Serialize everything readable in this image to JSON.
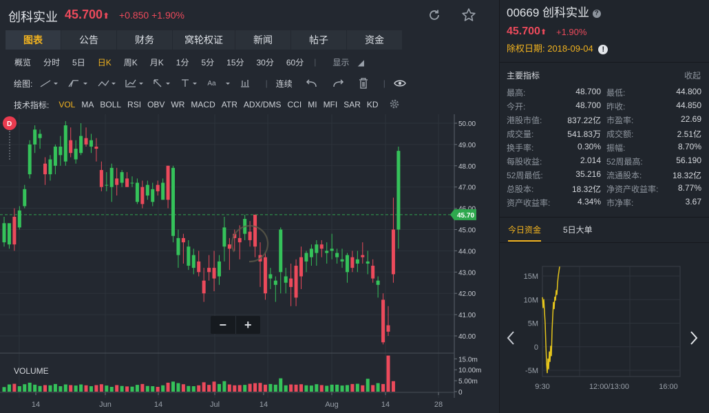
{
  "header": {
    "title": "创科实业",
    "price": "45.700",
    "up_arrow": "⬆",
    "change": "+0.850 +1.90%",
    "refresh_icon": "refresh-icon",
    "star_icon": "star-icon"
  },
  "tabs": [
    "图表",
    "公告",
    "财务",
    "窝轮权证",
    "新闻",
    "帖子",
    "资金"
  ],
  "periods": [
    "概览",
    "分时",
    "5日",
    "日K",
    "周K",
    "月K",
    "1分",
    "5分",
    "15分",
    "30分",
    "60分"
  ],
  "display_label": "显示",
  "draw": {
    "label": "绘图:",
    "tool_aa": "Aa",
    "continuous": "连续"
  },
  "indicators": {
    "label": "技术指标:",
    "items": [
      "VOL",
      "MA",
      "BOLL",
      "RSI",
      "OBV",
      "WR",
      "MACD",
      "ATR",
      "ADX/DMS",
      "CCI",
      "MI",
      "MFI",
      "SAR",
      "KD"
    ]
  },
  "chart_data": {
    "type": "candlestick",
    "y_ticks": [
      "50.00",
      "49.00",
      "48.00",
      "47.00",
      "46.00",
      "45.00",
      "44.00",
      "43.00",
      "42.00",
      "41.00",
      "40.00"
    ],
    "ylim": [
      39.5,
      50.2
    ],
    "x_ticks": [
      "14",
      "Jun",
      "14",
      "Jul",
      "14",
      "Aug",
      "14",
      "28"
    ],
    "current_price_label": "45.70",
    "marker_label": "D",
    "volume_label": "VOLUME",
    "volume_ticks": [
      "15.0m",
      "10.00m",
      "5.00m",
      "0"
    ],
    "colors": {
      "up": "#35c25a",
      "down": "#ec4a5b",
      "last_line": "#35c25a"
    },
    "candles": [
      {
        "o": 44.4,
        "h": 45.6,
        "l": 44.2,
        "c": 45.3
      },
      {
        "o": 44.3,
        "h": 45.0,
        "l": 44.1,
        "c": 45.3
      },
      {
        "o": 45.6,
        "h": 46.0,
        "l": 44.0,
        "c": 44.3
      },
      {
        "o": 45.1,
        "h": 46.1,
        "l": 45.0,
        "c": 45.9
      },
      {
        "o": 46.1,
        "h": 47.1,
        "l": 46.0,
        "c": 46.9
      },
      {
        "o": 47.6,
        "h": 49.2,
        "l": 47.4,
        "c": 49.0
      },
      {
        "o": 49.0,
        "h": 49.9,
        "l": 48.6,
        "c": 49.7
      },
      {
        "o": 49.3,
        "h": 49.7,
        "l": 48.8,
        "c": 49.5
      },
      {
        "o": 48.1,
        "h": 48.4,
        "l": 47.1,
        "c": 47.6
      },
      {
        "o": 47.6,
        "h": 48.5,
        "l": 47.3,
        "c": 48.3
      },
      {
        "o": 48.0,
        "h": 49.0,
        "l": 47.6,
        "c": 48.9
      },
      {
        "o": 48.5,
        "h": 49.4,
        "l": 48.0,
        "c": 48.9
      },
      {
        "o": 48.2,
        "h": 50.1,
        "l": 48.0,
        "c": 49.9
      },
      {
        "o": 49.2,
        "h": 49.8,
        "l": 48.4,
        "c": 48.6
      },
      {
        "o": 48.3,
        "h": 49.2,
        "l": 48.1,
        "c": 48.8
      },
      {
        "o": 48.6,
        "h": 50.0,
        "l": 48.5,
        "c": 49.4
      },
      {
        "o": 49.3,
        "h": 49.8,
        "l": 48.9,
        "c": 49.0
      },
      {
        "o": 48.9,
        "h": 49.5,
        "l": 48.6,
        "c": 49.2
      },
      {
        "o": 48.9,
        "h": 49.3,
        "l": 48.2,
        "c": 48.8
      },
      {
        "o": 47.8,
        "h": 48.2,
        "l": 46.8,
        "c": 47.0
      },
      {
        "o": 47.1,
        "h": 47.7,
        "l": 46.8,
        "c": 47.1
      },
      {
        "o": 47.0,
        "h": 48.1,
        "l": 46.3,
        "c": 47.9
      },
      {
        "o": 47.4,
        "h": 47.9,
        "l": 46.6,
        "c": 47.1
      },
      {
        "o": 47.2,
        "h": 47.8,
        "l": 47.0,
        "c": 47.7
      },
      {
        "o": 47.4,
        "h": 47.7,
        "l": 47.0,
        "c": 47.0
      },
      {
        "o": 47.2,
        "h": 47.5,
        "l": 47.0,
        "c": 47.2
      },
      {
        "o": 46.3,
        "h": 47.4,
        "l": 46.2,
        "c": 47.2
      },
      {
        "o": 47.0,
        "h": 47.3,
        "l": 46.0,
        "c": 46.2
      },
      {
        "o": 46.6,
        "h": 47.3,
        "l": 46.4,
        "c": 47.1
      },
      {
        "o": 46.3,
        "h": 47.2,
        "l": 46.1,
        "c": 46.9
      },
      {
        "o": 47.1,
        "h": 47.3,
        "l": 46.6,
        "c": 46.8
      },
      {
        "o": 46.4,
        "h": 47.4,
        "l": 46.4,
        "c": 47.2
      },
      {
        "o": 48.0,
        "h": 48.0,
        "l": 46.0,
        "c": 46.4
      },
      {
        "o": 44.7,
        "h": 48.0,
        "l": 44.4,
        "c": 47.9
      },
      {
        "o": 43.8,
        "h": 45.0,
        "l": 43.2,
        "c": 44.6
      },
      {
        "o": 44.6,
        "h": 44.8,
        "l": 43.4,
        "c": 44.4
      },
      {
        "o": 43.3,
        "h": 44.5,
        "l": 43.1,
        "c": 44.2
      },
      {
        "o": 43.2,
        "h": 44.1,
        "l": 42.9,
        "c": 43.8
      },
      {
        "o": 43.5,
        "h": 44.0,
        "l": 42.8,
        "c": 43.0
      },
      {
        "o": 42.6,
        "h": 43.2,
        "l": 41.6,
        "c": 42.0
      },
      {
        "o": 43.2,
        "h": 43.8,
        "l": 42.6,
        "c": 43.0
      },
      {
        "o": 43.2,
        "h": 44.0,
        "l": 42.1,
        "c": 42.7
      },
      {
        "o": 42.8,
        "h": 43.8,
        "l": 42.4,
        "c": 43.5
      },
      {
        "o": 44.2,
        "h": 45.6,
        "l": 43.5,
        "c": 45.1
      },
      {
        "o": 44.3,
        "h": 44.6,
        "l": 43.1,
        "c": 44.1
      },
      {
        "o": 44.8,
        "h": 45.0,
        "l": 44.0,
        "c": 44.6
      },
      {
        "o": 44.6,
        "h": 45.2,
        "l": 43.6,
        "c": 44.4
      },
      {
        "o": 44.8,
        "h": 45.7,
        "l": 44.5,
        "c": 45.5
      },
      {
        "o": 44.9,
        "h": 45.4,
        "l": 44.2,
        "c": 44.5
      },
      {
        "o": 45.7,
        "h": 45.7,
        "l": 43.7,
        "c": 44.2
      },
      {
        "o": 43.8,
        "h": 44.4,
        "l": 42.3,
        "c": 43.5
      },
      {
        "o": 43.7,
        "h": 43.9,
        "l": 41.7,
        "c": 42.0
      },
      {
        "o": 42.7,
        "h": 43.2,
        "l": 42.2,
        "c": 42.9
      },
      {
        "o": 42.4,
        "h": 42.8,
        "l": 41.6,
        "c": 42.6
      },
      {
        "o": 43.0,
        "h": 45.1,
        "l": 42.0,
        "c": 45.0
      },
      {
        "o": 42.5,
        "h": 43.2,
        "l": 42.0,
        "c": 42.8
      },
      {
        "o": 42.7,
        "h": 43.4,
        "l": 41.4,
        "c": 42.3
      },
      {
        "o": 43.3,
        "h": 43.6,
        "l": 41.4,
        "c": 41.8
      },
      {
        "o": 43.7,
        "h": 44.2,
        "l": 42.2,
        "c": 42.8
      },
      {
        "o": 43.5,
        "h": 44.0,
        "l": 43.0,
        "c": 43.9
      },
      {
        "o": 43.7,
        "h": 44.3,
        "l": 43.3,
        "c": 44.1
      },
      {
        "o": 43.9,
        "h": 44.5,
        "l": 43.3,
        "c": 44.3
      },
      {
        "o": 44.3,
        "h": 44.5,
        "l": 43.7,
        "c": 44.1
      },
      {
        "o": 43.9,
        "h": 44.4,
        "l": 43.4,
        "c": 44.0
      },
      {
        "o": 44.0,
        "h": 44.8,
        "l": 43.6,
        "c": 44.1
      },
      {
        "o": 43.7,
        "h": 44.1,
        "l": 43.4,
        "c": 43.9
      },
      {
        "o": 43.5,
        "h": 44.1,
        "l": 43.2,
        "c": 43.6
      },
      {
        "o": 43.0,
        "h": 43.9,
        "l": 42.5,
        "c": 43.8
      },
      {
        "o": 43.7,
        "h": 44.0,
        "l": 43.0,
        "c": 43.2
      },
      {
        "o": 43.4,
        "h": 44.0,
        "l": 43.0,
        "c": 43.6
      },
      {
        "o": 43.8,
        "h": 44.4,
        "l": 43.4,
        "c": 43.7
      },
      {
        "o": 43.4,
        "h": 44.0,
        "l": 42.9,
        "c": 43.5
      },
      {
        "o": 43.3,
        "h": 43.6,
        "l": 42.5,
        "c": 42.7
      },
      {
        "o": 42.4,
        "h": 42.8,
        "l": 41.8,
        "c": 42.6
      },
      {
        "o": 41.7,
        "h": 42.0,
        "l": 39.6,
        "c": 39.7
      },
      {
        "o": 40.5,
        "h": 41.4,
        "l": 40.0,
        "c": 40.2
      },
      {
        "o": 45.0,
        "h": 46.5,
        "l": 42.5,
        "c": 42.9
      },
      {
        "o": 45.0,
        "h": 48.9,
        "l": 44.1,
        "c": 48.7
      }
    ],
    "volumes": [
      2.1,
      3.3,
      3.6,
      2.5,
      3.4,
      4.1,
      3.2,
      2.6,
      3.0,
      2.9,
      3.5,
      2.5,
      3.3,
      3.0,
      2.8,
      3.3,
      2.9,
      2.5,
      3.0,
      3.4,
      2.8,
      2.2,
      3.0,
      2.6,
      2.4,
      2.3,
      3.1,
      3.5,
      2.6,
      2.5,
      2.2,
      2.9,
      4.1,
      4.6,
      3.9,
      3.4,
      2.6,
      2.5,
      2.9,
      4.3,
      3.1,
      4.6,
      3.5,
      4.8,
      3.3,
      2.9,
      3.0,
      3.1,
      3.6,
      3.9,
      4.0,
      3.2,
      3.5,
      3.2,
      6.1,
      2.9,
      3.3,
      3.2,
      3.4,
      2.9,
      2.8,
      3.4,
      3.0,
      2.7,
      3.2,
      3.2,
      2.8,
      3.0,
      3.5,
      3.6,
      2.9,
      5.9,
      3.0,
      3.9,
      3.5,
      16.5,
      4.8
    ]
  },
  "quote": {
    "code_name": "00669 创科实业",
    "help_icon": "help-icon",
    "price": "45.700",
    "up_arrow": "⬆",
    "change": "+1.90%",
    "ex_date": "除权日期: 2018-09-04",
    "info_icon": "info-icon",
    "section_title": "主要指标",
    "collapse": "收起",
    "metrics": [
      {
        "l1": "最高:",
        "v1": "48.700",
        "c1": "up",
        "l2": "最低:",
        "v2": "44.800",
        "c2": "dn"
      },
      {
        "l1": "今开:",
        "v1": "48.700",
        "c1": "",
        "l2": "昨收:",
        "v2": "44.850",
        "c2": ""
      },
      {
        "l1": "港股市值:",
        "v1": "837.22亿",
        "c1": "",
        "l2": "市盈率:",
        "v2": "22.69",
        "c2": ""
      },
      {
        "l1": "成交量:",
        "v1": "541.83万",
        "c1": "",
        "l2": "成交额:",
        "v2": "2.51亿",
        "c2": ""
      },
      {
        "l1": "换手率:",
        "v1": "0.30%",
        "c1": "",
        "l2": "振幅:",
        "v2": "8.70%",
        "c2": ""
      },
      {
        "l1": "每股收益:",
        "v1": "2.014",
        "c1": "",
        "l2": "52周最高:",
        "v2": "56.190",
        "c2": ""
      },
      {
        "l1": "52周最低:",
        "v1": "35.216",
        "c1": "",
        "l2": "流通股本:",
        "v2": "18.32亿",
        "c2": ""
      },
      {
        "l1": "总股本:",
        "v1": "18.32亿",
        "c1": "",
        "l2": "净资产收益率:",
        "v2": "8.77%",
        "c2": ""
      },
      {
        "l1": "资产收益率:",
        "v1": "4.34%",
        "c1": "",
        "l2": "市净率:",
        "v2": "3.67",
        "c2": ""
      }
    ],
    "flow_tabs": [
      "今日资金",
      "5日大单"
    ],
    "flow_chart": {
      "y_ticks": [
        "15M",
        "10M",
        "5M",
        "0",
        "-5M"
      ],
      "x_ticks": [
        "9:30",
        "12:00/13:00",
        "16:00"
      ],
      "prev_icon": "chevron-left-icon",
      "next_icon": "chevron-right-icon"
    }
  }
}
